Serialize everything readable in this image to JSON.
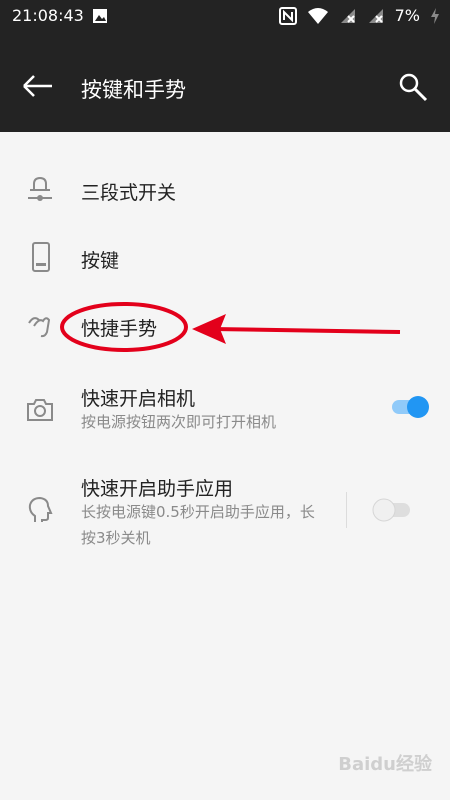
{
  "status_bar": {
    "time": "21:08:43",
    "battery": "7%"
  },
  "header": {
    "title": "按键和手势"
  },
  "settings": [
    {
      "title": "三段式开关",
      "icon": "bell-slider-icon"
    },
    {
      "title": "按键",
      "icon": "phone-icon"
    },
    {
      "title": "快捷手势",
      "icon": "gesture-icon"
    },
    {
      "title": "快速开启相机",
      "subtitle": "按电源按钮两次即可打开相机",
      "icon": "camera-icon",
      "toggle": true
    },
    {
      "title": "快速开启助手应用",
      "subtitle": "长按电源键0.5秒开启助手应用，长按3秒关机",
      "icon": "assistant-head-icon",
      "toggle": false
    }
  ],
  "watermark": "Baidu经验",
  "colors": {
    "bar_background": "#232323",
    "page_background": "#f5f5f5",
    "accent": "#2196f3",
    "annotation_red": "#e3001b"
  }
}
